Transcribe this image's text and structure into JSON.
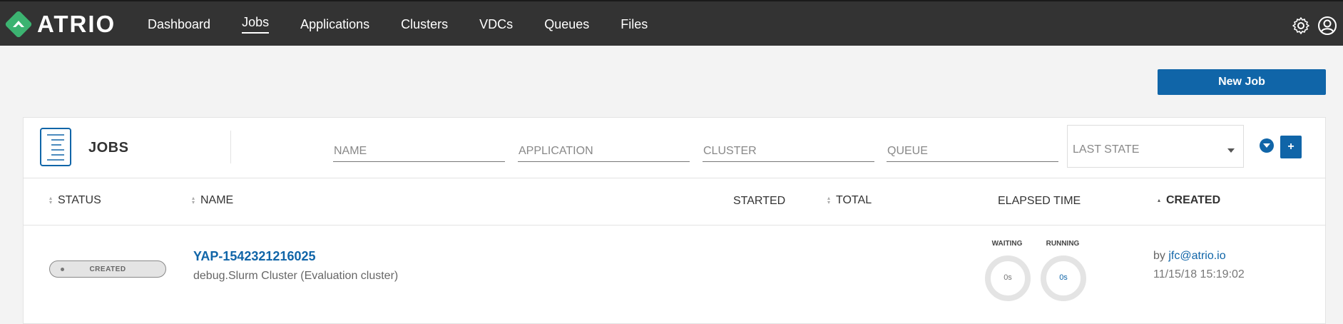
{
  "app": {
    "brand": "ATRIO"
  },
  "nav": {
    "items": [
      {
        "label": "Dashboard"
      },
      {
        "label": "Jobs"
      },
      {
        "label": "Applications"
      },
      {
        "label": "Clusters"
      },
      {
        "label": "VDCs"
      },
      {
        "label": "Queues"
      },
      {
        "label": "Files"
      }
    ],
    "active": "Jobs"
  },
  "toolbar": {
    "new_job_label": "New Job"
  },
  "jobs_panel": {
    "title": "JOBS",
    "filters": {
      "name_placeholder": "NAME",
      "application_placeholder": "APPLICATION",
      "cluster_placeholder": "CLUSTER",
      "queue_placeholder": "QUEUE",
      "last_state_label": "LAST STATE"
    },
    "add_label": "+",
    "columns": {
      "status": "STATUS",
      "name": "NAME",
      "started": "STARTED",
      "total": "TOTAL",
      "elapsed": "ELAPSED TIME",
      "created": "CREATED"
    },
    "rows": [
      {
        "status": "CREATED",
        "name": "YAP-1542321216025",
        "subtitle": "debug.Slurm Cluster (Evaluation cluster)",
        "waiting_label": "WAITING",
        "waiting_value": "0s",
        "running_label": "RUNNING",
        "running_value": "0s",
        "by_prefix": "by",
        "by_user": "jfc@atrio.io",
        "created": "11/15/18 15:19:02"
      }
    ]
  },
  "colors": {
    "topbar": "#333333",
    "accent": "#1065a8",
    "logo_green": "#3cb371"
  },
  "icons": [
    "atrio-logo-icon",
    "gear-icon",
    "user-icon",
    "jobs-document-icon",
    "chevron-down-icon",
    "sort-icon"
  ]
}
